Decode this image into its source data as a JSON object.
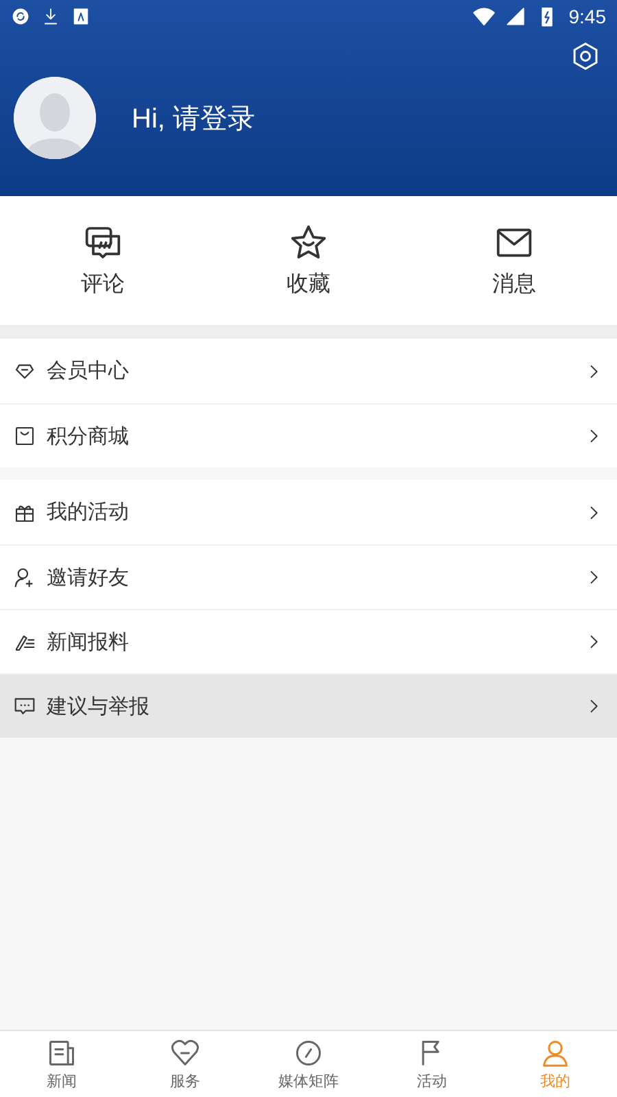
{
  "status_bar": {
    "time": "9:45"
  },
  "header": {
    "greeting": "Hi, 请登录"
  },
  "quick_actions": [
    {
      "kind": "comment",
      "label": "评论"
    },
    {
      "kind": "star",
      "label": "收藏"
    },
    {
      "kind": "mail",
      "label": "消息"
    }
  ],
  "menu_groups": [
    {
      "items": [
        {
          "kind": "diamond",
          "label": "会员中心",
          "selected": false
        },
        {
          "kind": "bag",
          "label": "积分商城",
          "selected": false
        }
      ]
    },
    {
      "items": [
        {
          "kind": "gift",
          "label": "我的活动",
          "selected": false
        },
        {
          "kind": "invite",
          "label": "邀请好友",
          "selected": false
        },
        {
          "kind": "pen",
          "label": "新闻报料",
          "selected": false
        },
        {
          "kind": "chat",
          "label": "建议与举报",
          "selected": true
        }
      ]
    }
  ],
  "tab_bar": [
    {
      "kind": "news",
      "label": "新闻",
      "selected": false
    },
    {
      "kind": "service",
      "label": "服务",
      "selected": false
    },
    {
      "kind": "media",
      "label": "媒体矩阵",
      "selected": false
    },
    {
      "kind": "activity",
      "label": "活动",
      "selected": false
    },
    {
      "kind": "mine",
      "label": "我的",
      "selected": true
    }
  ]
}
